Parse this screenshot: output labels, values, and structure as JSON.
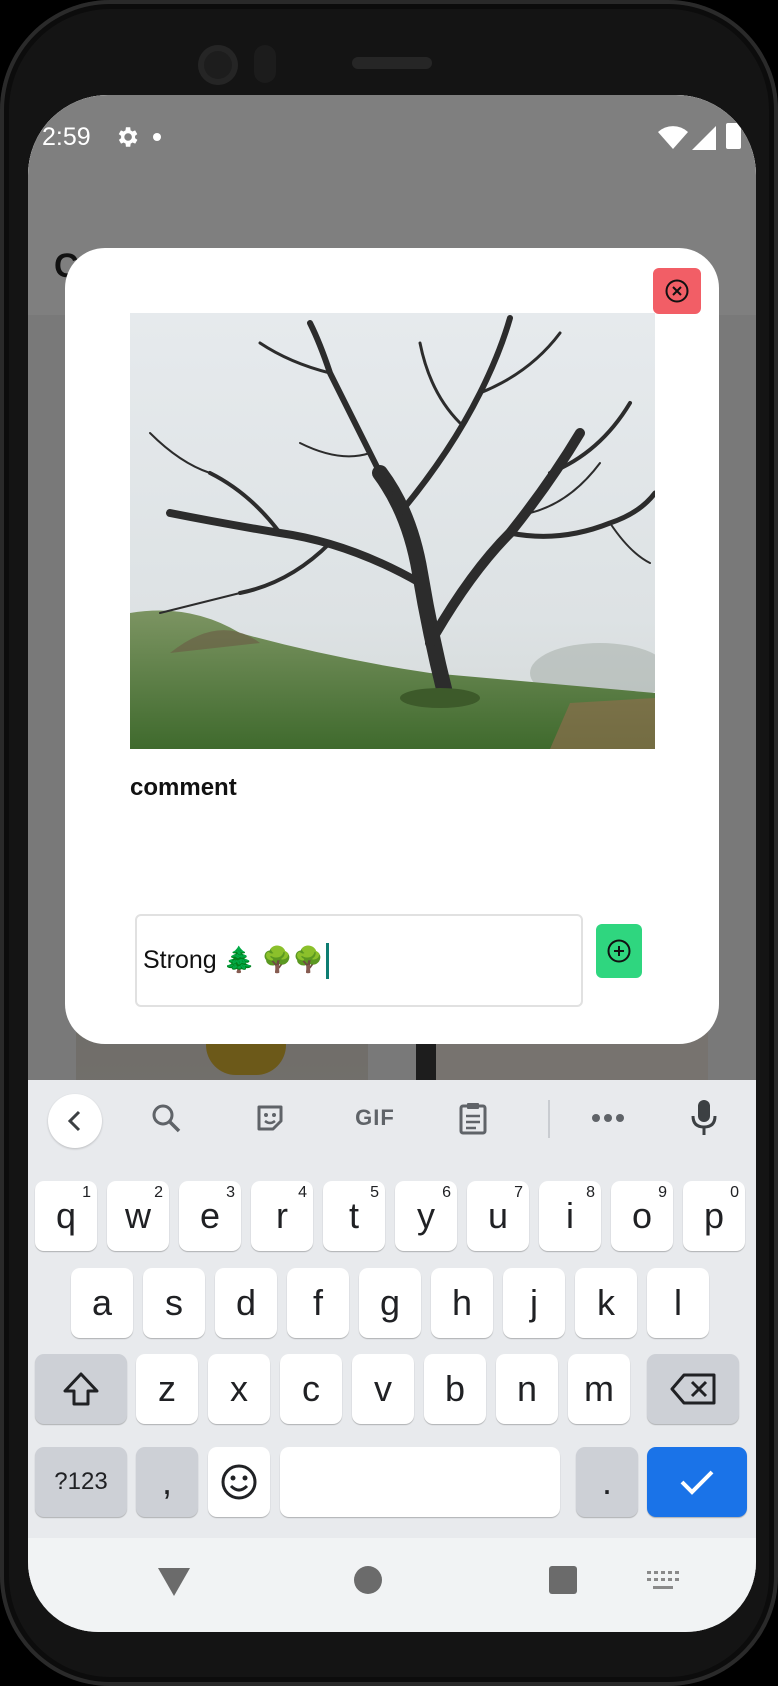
{
  "status_bar": {
    "time": "2:59"
  },
  "app": {
    "title": "C"
  },
  "dialog": {
    "comment_label": "comment",
    "comment_value": "Strong 🌲 🌳🌳"
  },
  "keyboard": {
    "toolbar": {
      "gif_label": "GIF"
    },
    "row1": [
      {
        "label": "q",
        "hint": "1"
      },
      {
        "label": "w",
        "hint": "2"
      },
      {
        "label": "e",
        "hint": "3"
      },
      {
        "label": "r",
        "hint": "4"
      },
      {
        "label": "t",
        "hint": "5"
      },
      {
        "label": "y",
        "hint": "6"
      },
      {
        "label": "u",
        "hint": "7"
      },
      {
        "label": "i",
        "hint": "8"
      },
      {
        "label": "o",
        "hint": "9"
      },
      {
        "label": "p",
        "hint": "0"
      }
    ],
    "row2": [
      "a",
      "s",
      "d",
      "f",
      "g",
      "h",
      "j",
      "k",
      "l"
    ],
    "row3": [
      "z",
      "x",
      "c",
      "v",
      "b",
      "n",
      "m"
    ],
    "symbols_label": "?123",
    "comma_label": ",",
    "period_label": "."
  },
  "colors": {
    "close_button": "#f25e66",
    "add_button": "#2fd67f",
    "enter_key": "#1a73e8",
    "caret": "#0d7d72"
  }
}
